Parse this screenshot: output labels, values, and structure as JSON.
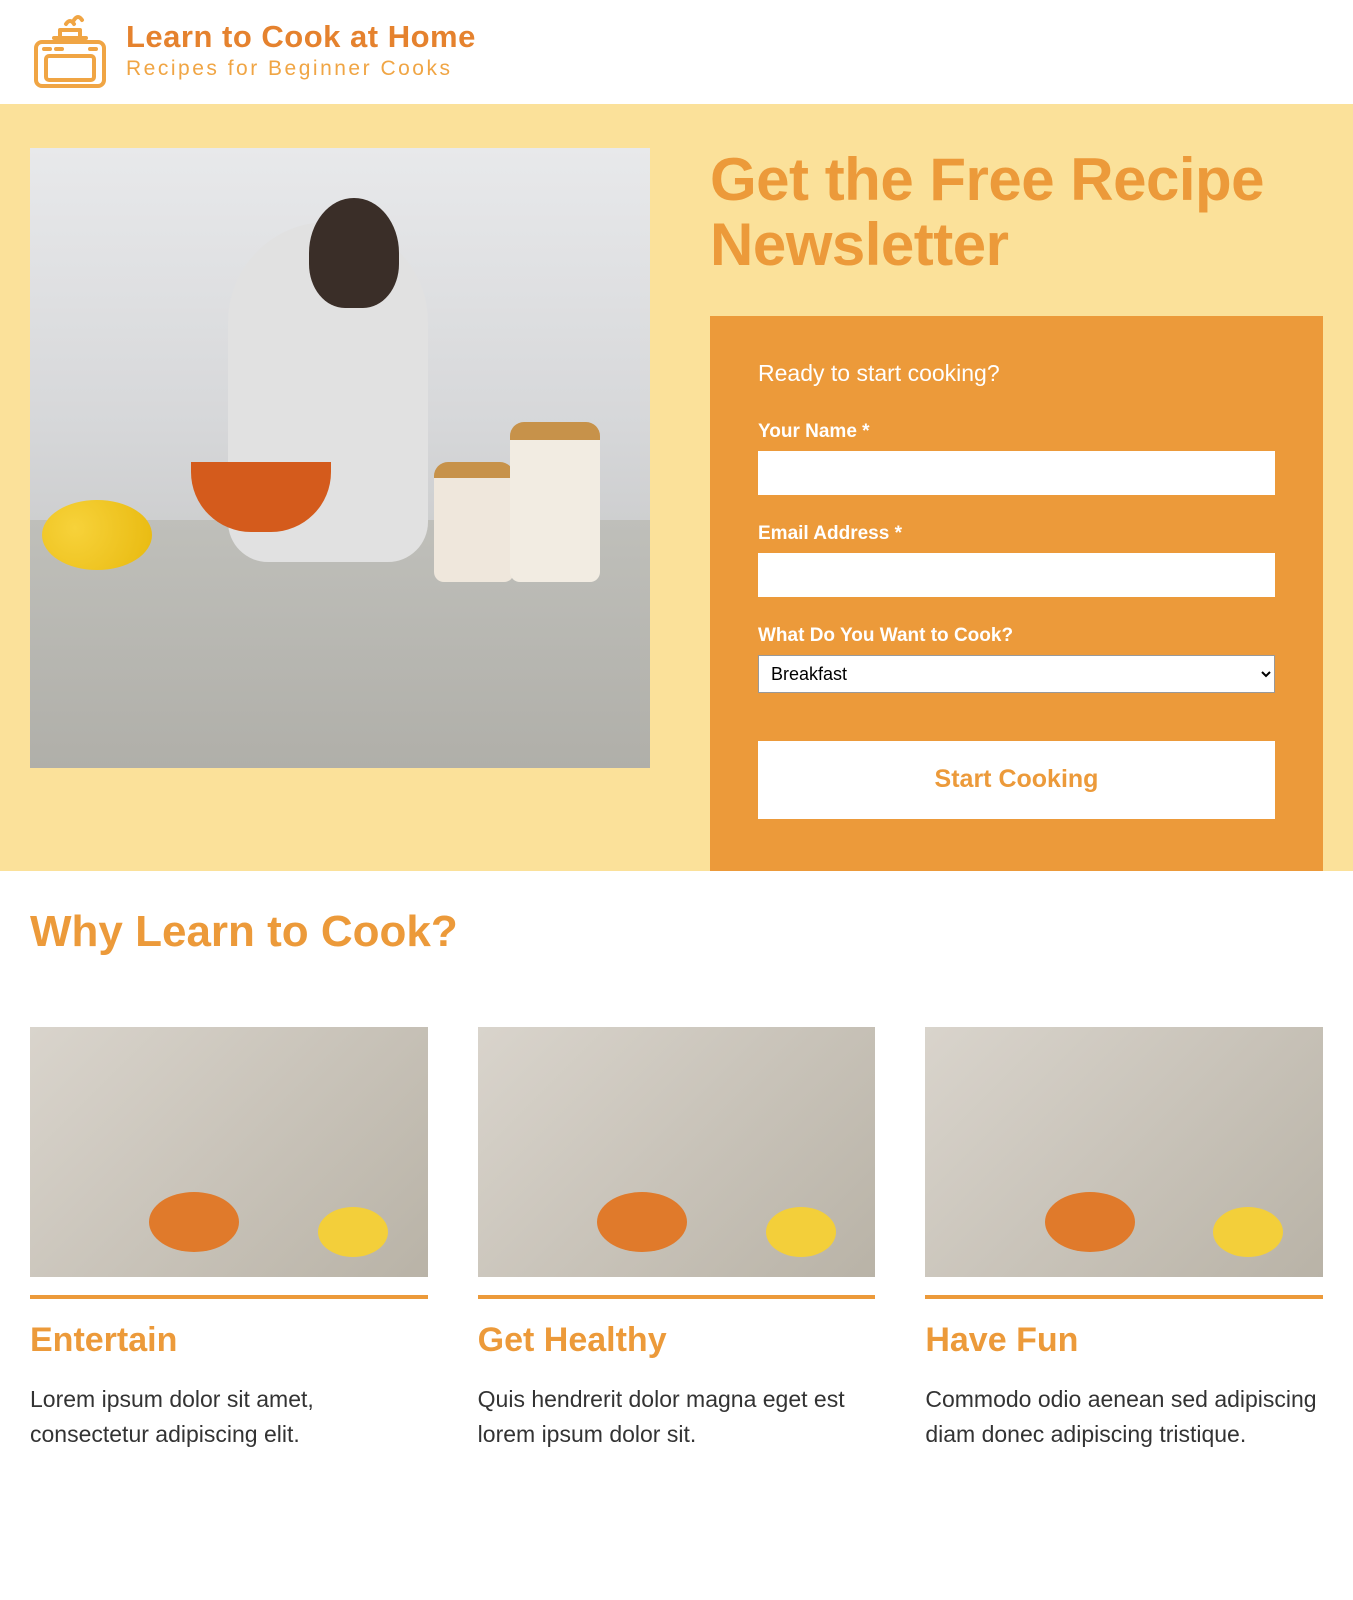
{
  "header": {
    "site_title": "Learn to Cook at Home",
    "tagline": "Recipes for Beginner Cooks"
  },
  "hero": {
    "title": "Get the Free Recipe Newsletter",
    "form": {
      "intro": "Ready to start cooking?",
      "name_label": "Your Name *",
      "email_label": "Email Address *",
      "select_label": "What Do You Want to Cook?",
      "select_value": "Breakfast",
      "submit_label": "Start Cooking"
    }
  },
  "why": {
    "title": "Why Learn to Cook?",
    "cards": [
      {
        "title": "Entertain",
        "text": "Lorem ipsum dolor sit amet, consectetur adipiscing elit."
      },
      {
        "title": "Get Healthy",
        "text": "Quis hendrerit dolor magna eget est lorem ipsum dolor sit."
      },
      {
        "title": "Have Fun",
        "text": "Commodo odio aenean sed adipiscing diam donec adipiscing tristique."
      }
    ]
  },
  "colors": {
    "accent": "#ec9a3a",
    "accent_dark": "#e5822e",
    "hero_bg": "#fbe19a"
  }
}
